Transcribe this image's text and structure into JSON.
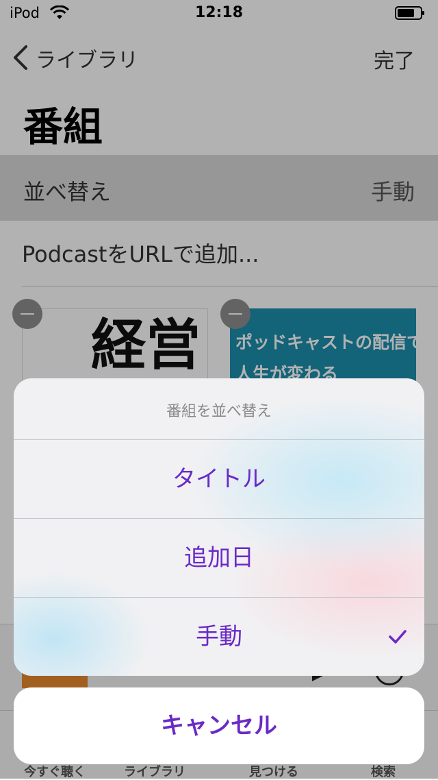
{
  "status_bar": {
    "carrier": "iPod",
    "time": "12:18"
  },
  "nav": {
    "back_label": "ライブラリ",
    "done_label": "完了",
    "title": "番組"
  },
  "sort_row": {
    "label": "並べ替え",
    "value": "手動"
  },
  "add_url": {
    "label": "PodcastをURLで追加..."
  },
  "artwork": {
    "show1_text": "経営",
    "show2_line1": "ポッドキャストの配信で",
    "show2_line2": "人生が変わる"
  },
  "tab_bar": {
    "items": [
      "今すぐ聴く",
      "ライブラリ",
      "見つける",
      "検索"
    ]
  },
  "action_sheet": {
    "title": "番組を並べ替え",
    "options": [
      {
        "label": "タイトル",
        "selected": false
      },
      {
        "label": "追加日",
        "selected": false
      },
      {
        "label": "手動",
        "selected": true
      }
    ],
    "cancel_label": "キャンセル"
  },
  "colors": {
    "accent": "#6a2ac7",
    "dim_overlay": "rgba(0,0,0,0.30)"
  },
  "icons": [
    "wifi-icon",
    "battery-icon",
    "back-chevron-icon",
    "delete-minus-icon",
    "play-icon",
    "checkmark-icon"
  ]
}
